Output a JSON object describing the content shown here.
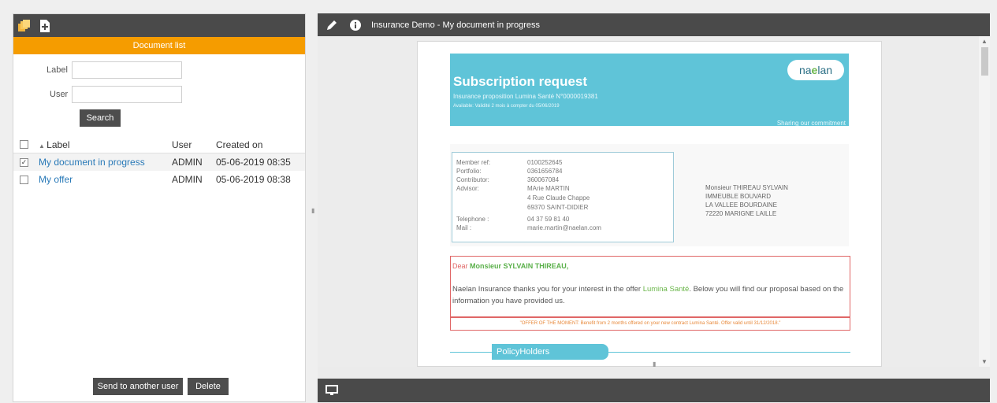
{
  "left": {
    "header_title": "Document list",
    "form": {
      "label_field_label": "Label",
      "label_field_value": "",
      "user_field_label": "User",
      "user_field_value": "",
      "search_button": "Search"
    },
    "grid": {
      "columns": {
        "label": "Label",
        "user": "User",
        "created": "Created on"
      },
      "rows": [
        {
          "label": "My document in progress",
          "user": "ADMIN",
          "created": "05-06-2019 08:35",
          "checked": true
        },
        {
          "label": "My offer",
          "user": "ADMIN",
          "created": "05-06-2019 08:38",
          "checked": false
        }
      ]
    },
    "footer": {
      "send_button": "Send to another user",
      "delete_button": "Delete"
    }
  },
  "right": {
    "title": "Insurance Demo - My document in progress",
    "document": {
      "banner_title": "Subscription request",
      "banner_sub": "Insurance proposition Lumina Santé N°0000019381",
      "banner_sub2": "Available: Validité 2 mois à compter du 05/06/2019",
      "logo_text_a": "na",
      "logo_text_b": "e",
      "logo_text_c": "lan",
      "tagline": "Sharing our commitment",
      "member": {
        "member_ref_label": "Member ref:",
        "member_ref": "0100252645",
        "portfolio_label": "Portfolio:",
        "portfolio": "0361656784",
        "contributor_label": "Contributor:",
        "contributor": "360067084",
        "advisor_label": "Advisor:",
        "advisor_name": "MArie MARTIN",
        "advisor_addr1": "4 Rue Claude Chappe",
        "advisor_addr2": "69370 SAINT-DIDIER",
        "telephone_label": "Telephone :",
        "telephone": "04 37 59 81 40",
        "mail_label": "Mail :",
        "mail": "marie.martin@naelan.com"
      },
      "address": {
        "line1": "Monsieur THIREAU SYLVAIN",
        "line2": "IMMEUBLE BOUVARD",
        "line3": "LA VALLEE BOURDAINE",
        "line4": "72220 MARIGNE LAILLE"
      },
      "letter": {
        "dear": "Dear",
        "name": "Monsieur SYLVAIN THIREAU,",
        "body_a": "Naelan Insurance thanks you for your interest in the offer ",
        "body_offer": "Lumina Santé",
        "body_b": ". Below you will find our proposal based on the information you have provided us."
      },
      "offer_banner": "\"OFFER OF THE MOMENT: Benefit from 2 months offered on your new contract Lumina Santé. Offer valid until 31/12/2018.\"",
      "policy_tab": "PolicyHolders"
    }
  },
  "colors": {
    "toolbar": "#4a4a4a",
    "orange": "#f59c00",
    "teal": "#5fc4d8",
    "link": "#2a7ab8",
    "red": "#e06666",
    "green": "#6ab64a"
  }
}
